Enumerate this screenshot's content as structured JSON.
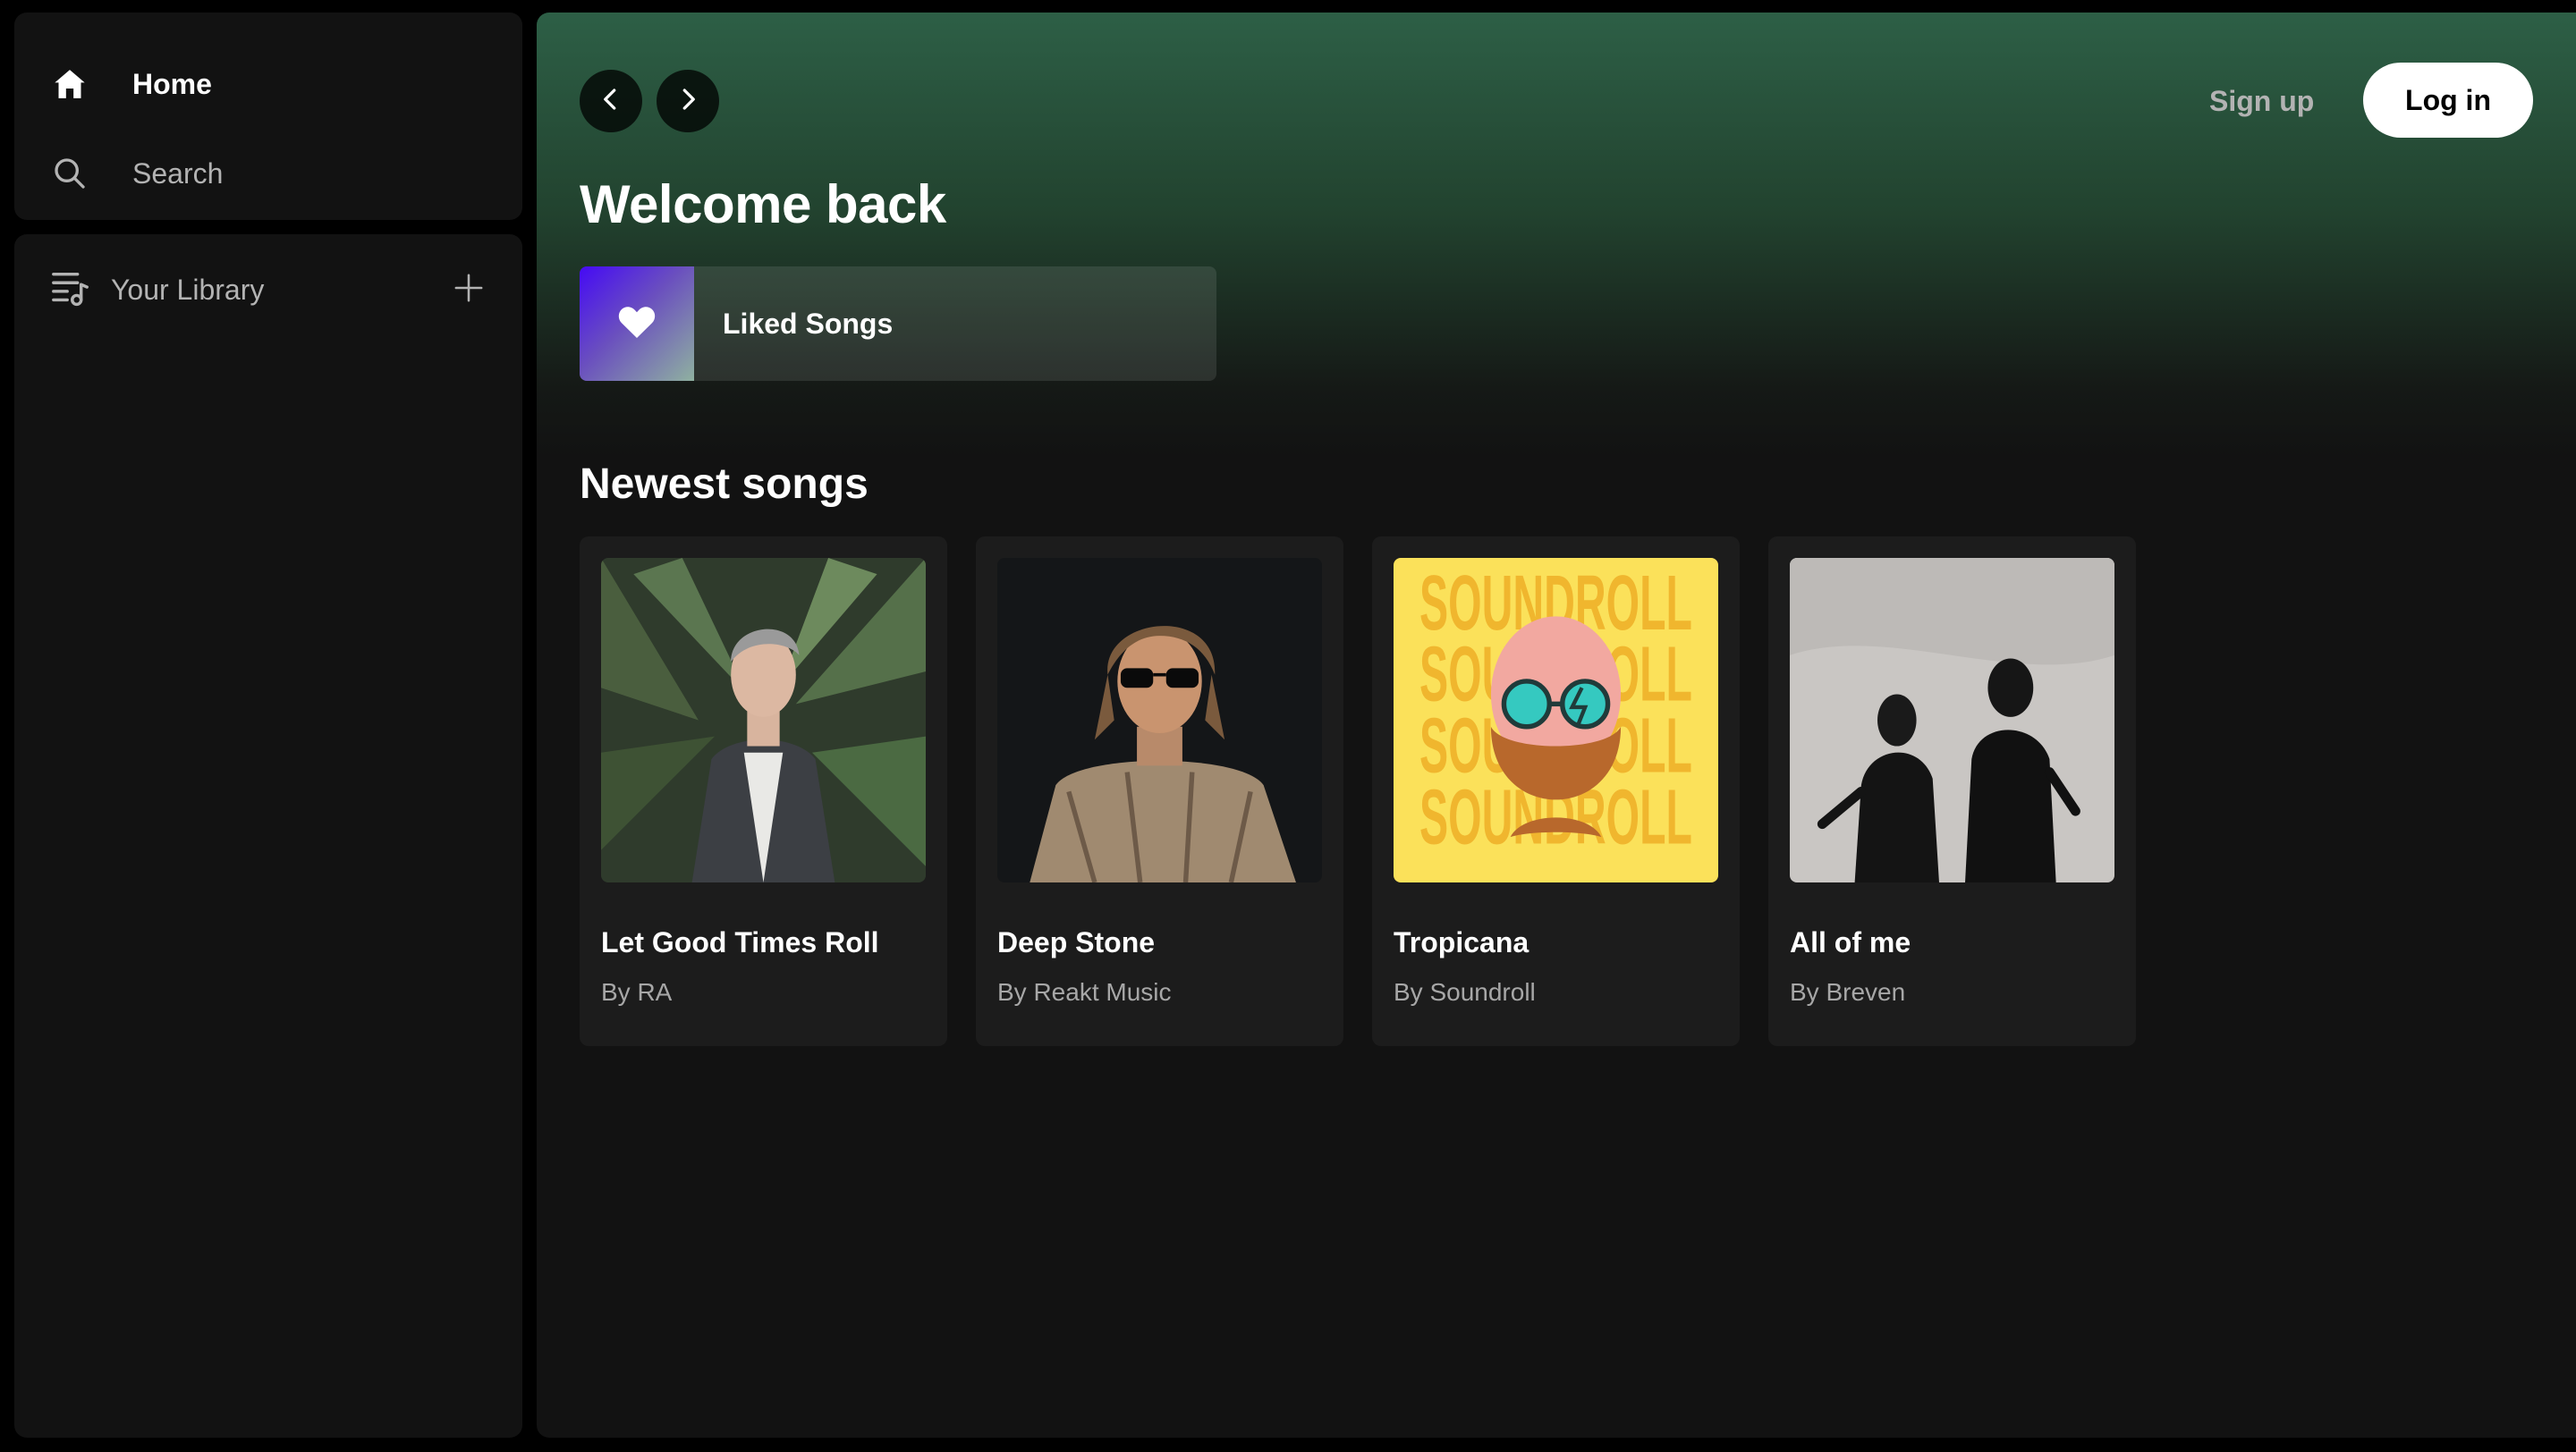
{
  "sidebar": {
    "home_label": "Home",
    "search_label": "Search",
    "library_label": "Your Library"
  },
  "header": {
    "signup_label": "Sign up",
    "login_label": "Log in"
  },
  "main": {
    "greeting": "Welcome back",
    "liked_songs_label": "Liked Songs",
    "section_title": "Newest songs",
    "songs": [
      {
        "title": "Let Good Times Roll",
        "artist": "By RA"
      },
      {
        "title": "Deep Stone",
        "artist": "By Reakt Music"
      },
      {
        "title": "Tropicana",
        "artist": "By Soundroll"
      },
      {
        "title": "All of me",
        "artist": "By Breven"
      }
    ],
    "cover_text": "SOUNDROLL"
  },
  "icons": {
    "home": "home-icon",
    "search": "search-icon",
    "library": "library-icon",
    "add": "plus-icon",
    "back": "chevron-left-icon",
    "forward": "chevron-right-icon",
    "heart": "heart-icon"
  },
  "colors": {
    "header_gradient_top": "#2d5f46",
    "panel_bg": "#121212",
    "card_bg": "#1c1c1c",
    "login_bg": "#ffffff",
    "muted_text": "#b3b3b3",
    "liked_gradient_start": "#450af5",
    "liked_gradient_end": "#8fb1a0"
  }
}
